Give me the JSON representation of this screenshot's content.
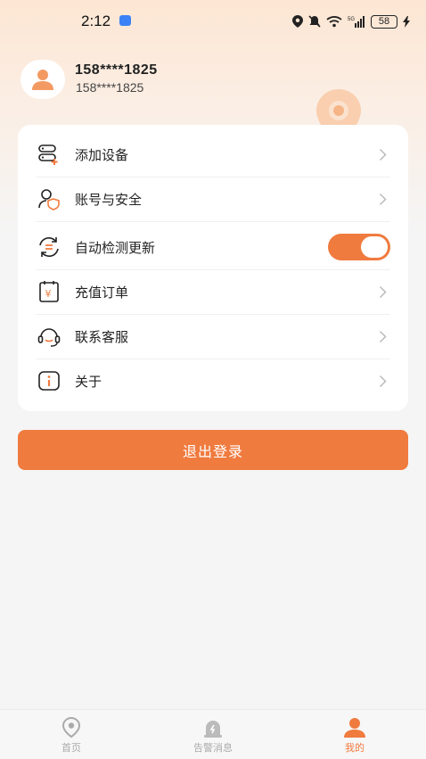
{
  "status_bar": {
    "time": "2:12",
    "battery": "58"
  },
  "profile": {
    "name": "158****1825",
    "phone": "158****1825"
  },
  "menu": {
    "items": [
      {
        "label": "添加设备",
        "icon": "add-device-icon"
      },
      {
        "label": "账号与安全",
        "icon": "account-security-icon"
      },
      {
        "label": "自动检测更新",
        "icon": "auto-update-icon",
        "toggle": true
      },
      {
        "label": "充值订单",
        "icon": "recharge-order-icon"
      },
      {
        "label": "联系客服",
        "icon": "customer-service-icon"
      },
      {
        "label": "关于",
        "icon": "about-icon"
      }
    ]
  },
  "logout": {
    "label": "退出登录"
  },
  "tabs": [
    {
      "label": "首页",
      "icon": "home-location-icon",
      "active": false
    },
    {
      "label": "告警消息",
      "icon": "alarm-message-icon",
      "active": false
    },
    {
      "label": "我的",
      "icon": "profile-icon",
      "active": true
    }
  ],
  "colors": {
    "accent": "#f07b3f",
    "background": "#f5f5f5"
  }
}
